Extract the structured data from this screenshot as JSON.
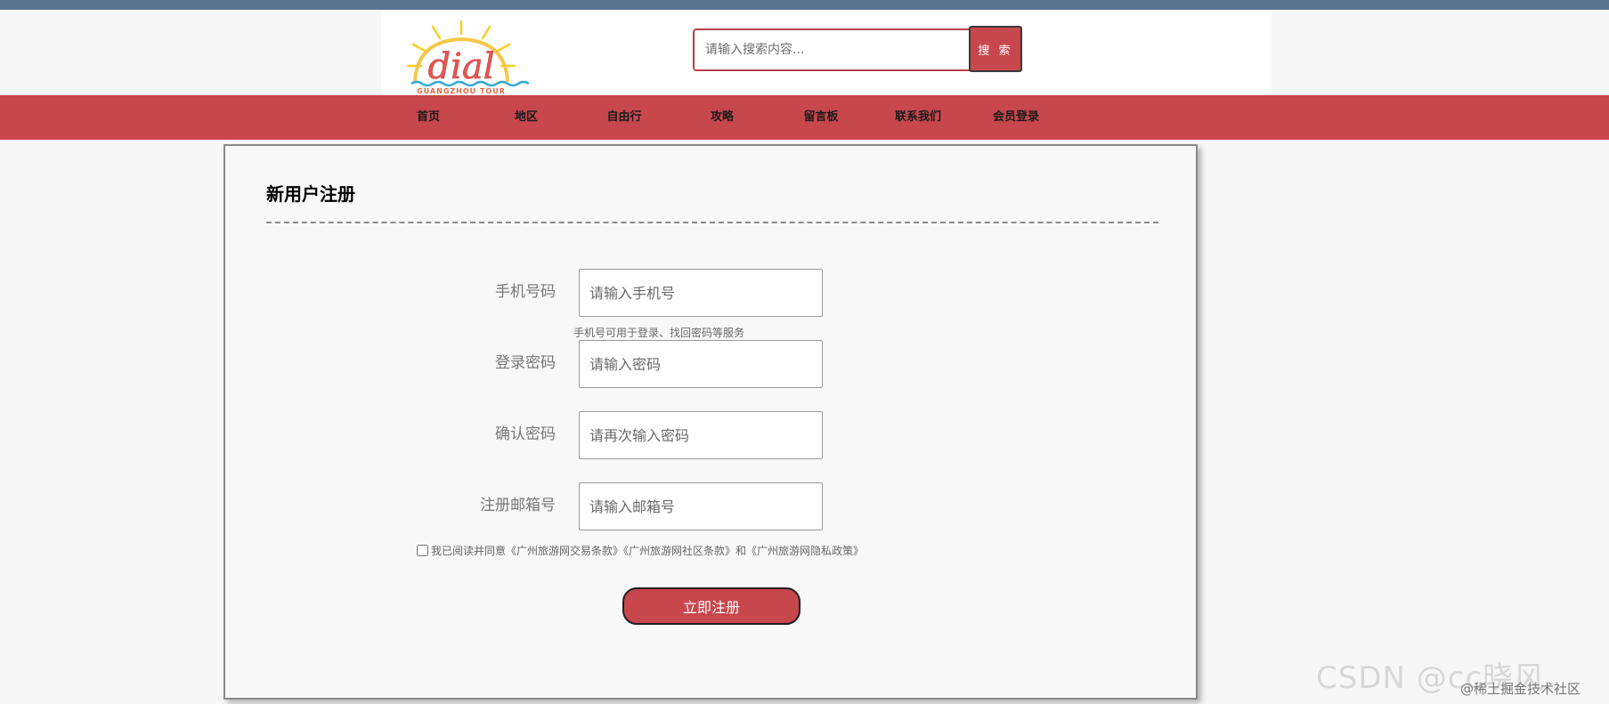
{
  "site": {
    "logo_text": "dial",
    "logo_subtext": "GUANGZHOU TOUR"
  },
  "search": {
    "placeholder": "请输入搜索内容...",
    "button_label": "搜 索"
  },
  "nav": {
    "items": [
      {
        "label": "首页"
      },
      {
        "label": "地区"
      },
      {
        "label": "自由行"
      },
      {
        "label": "攻略"
      },
      {
        "label": "留言板"
      },
      {
        "label": "联系我们"
      },
      {
        "label": "会员登录"
      }
    ]
  },
  "form": {
    "title": "新用户注册",
    "fields": [
      {
        "label": "手机号码",
        "placeholder": "请输入手机号",
        "value": ""
      },
      {
        "label": "登录密码",
        "placeholder": "请输入密码",
        "value": ""
      },
      {
        "label": "确认密码",
        "placeholder": "请再次输入密码",
        "value": ""
      },
      {
        "label": "注册邮箱号",
        "placeholder": "请输入邮箱号",
        "value": ""
      }
    ],
    "phone_hint": "手机号可用于登录、找回密码等服务",
    "agreement_text": "我已阅读并同意《广州旅游网交易条款》《广州旅游网社区条款》和《广州旅游网隐私政策》",
    "agreement_checked": false,
    "submit_label": "立即注册"
  },
  "watermark": {
    "text": "CSDN @cc晓风",
    "sub_text": "@稀土掘金技术社区"
  },
  "colors": {
    "top_strip": "#5b7590",
    "accent": "#c8474d",
    "search_border": "#b5434c",
    "page_background": "#f7f7f7"
  }
}
